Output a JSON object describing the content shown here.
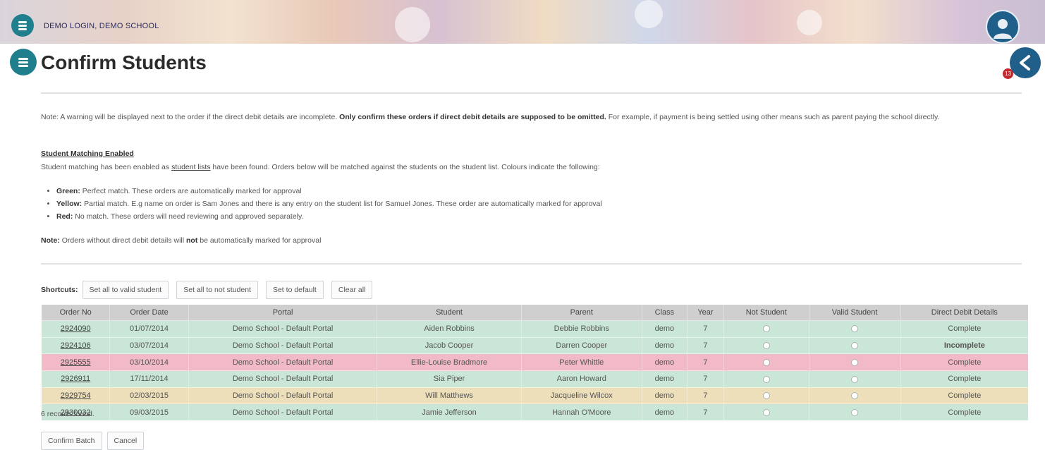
{
  "header": {
    "title": "DEMO LOGIN, DEMO SCHOOL",
    "logo_icon": "school-logo-icon",
    "avatar_icon": "user-avatar-icon",
    "colors": {
      "teal": "#1f7f8c",
      "blue": "#1f5f8a",
      "alert": "#c0282d"
    }
  },
  "page": {
    "title": "Confirm Students",
    "menu_icon": "menu-icon",
    "back_icon": "back-chevron-icon",
    "notification_count": "13"
  },
  "notes": {
    "warning_prefix": "Note: A warning will be displayed next to the order if the direct debit details are incomplete. ",
    "warning_bold": "Only confirm these orders if direct debit details are supposed to be omitted.",
    "warning_suffix": " For example, if payment is being settled using other means such as parent paying the school directly.",
    "matching_heading": "Student Matching Enabled",
    "matching_prefix": "Student matching has been enabled as ",
    "matching_link": "student lists",
    "matching_suffix": " have been found. Orders below will be matched against the students on the student list. Colours indicate the following:",
    "bullets": [
      {
        "label": "Green:",
        "text": " Perfect match. These orders are automatically marked for approval"
      },
      {
        "label": "Yellow:",
        "text": " Partial match. E.g name on order is Sam Jones and there is any entry on the student list for Samuel Jones. These order are automatically marked for approval"
      },
      {
        "label": "Red:",
        "text": " No match. These orders will need reviewing and approved separately."
      }
    ],
    "final_label": "Note:",
    "final_pre": " Orders without direct debit details will ",
    "final_bold": "not",
    "final_post": " be automatically marked for approval"
  },
  "shortcuts": {
    "label": "Shortcuts:",
    "buttons": [
      "Set all to valid student",
      "Set all to not student",
      "Set to default",
      "Clear all"
    ]
  },
  "table": {
    "columns": [
      "Order No",
      "Order Date",
      "Portal",
      "Student",
      "Parent",
      "Class",
      "Year",
      "Not Student",
      "Valid Student",
      "Direct Debit Details"
    ],
    "rows": [
      {
        "match": "green",
        "order_no": "2924090",
        "date": "01/07/2014",
        "portal": "Demo School - Default Portal",
        "student": "Aiden Robbins",
        "parent": "Debbie Robbins",
        "class": "demo",
        "year": "7",
        "dd": "Complete"
      },
      {
        "match": "green",
        "order_no": "2924106",
        "date": "03/07/2014",
        "portal": "Demo School - Default Portal",
        "student": "Jacob Cooper",
        "parent": "Darren Cooper",
        "class": "demo",
        "year": "7",
        "dd": "Incomplete"
      },
      {
        "match": "red",
        "order_no": "2925555",
        "date": "03/10/2014",
        "portal": "Demo School - Default Portal",
        "student": "Ellie-Louise Bradmore",
        "parent": "Peter Whittle",
        "class": "demo",
        "year": "7",
        "dd": "Complete"
      },
      {
        "match": "green",
        "order_no": "2926911",
        "date": "17/11/2014",
        "portal": "Demo School - Default Portal",
        "student": "Sia Piper",
        "parent": "Aaron Howard",
        "class": "demo",
        "year": "7",
        "dd": "Complete"
      },
      {
        "match": "yellow",
        "order_no": "2929754",
        "date": "02/03/2015",
        "portal": "Demo School - Default Portal",
        "student": "Will Matthews",
        "parent": "Jacqueline Wilcox",
        "class": "demo",
        "year": "7",
        "dd": "Complete"
      },
      {
        "match": "green",
        "order_no": "2930032",
        "date": "09/03/2015",
        "portal": "Demo School - Default Portal",
        "student": "Jamie Jefferson",
        "parent": "Hannah O'Moore",
        "class": "demo",
        "year": "7",
        "dd": "Complete"
      }
    ],
    "records_text": "6 records found."
  },
  "footer": {
    "confirm_label": "Confirm Batch",
    "cancel_label": "Cancel"
  }
}
